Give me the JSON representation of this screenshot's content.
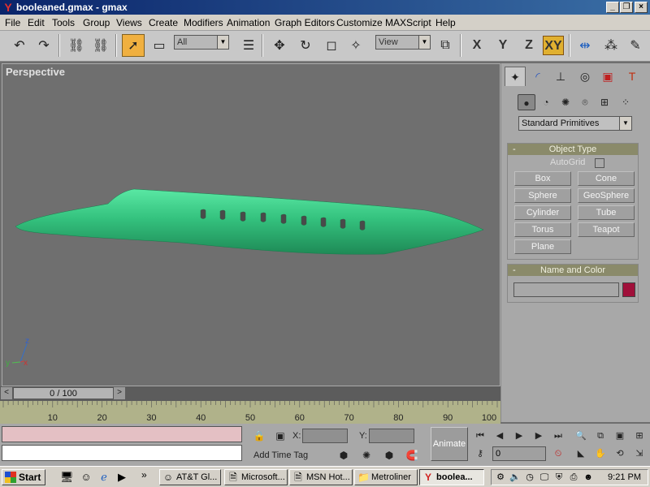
{
  "window": {
    "title": "booleaned.gmax - gmax",
    "minimize_label": "_",
    "restore_label": "❐",
    "close_label": "×"
  },
  "menu": [
    "File",
    "Edit",
    "Tools",
    "Group",
    "Views",
    "Create",
    "Modifiers",
    "Animation",
    "Graph Editors",
    "Customize",
    "MAXScript",
    "Help"
  ],
  "toolbar": {
    "selection_filter": "All",
    "ref_coord": "View",
    "axis_x": "X",
    "axis_y": "Y",
    "axis_z": "Z",
    "axis_xy": "XY"
  },
  "viewport": {
    "label": "Perspective",
    "axis_x": "x",
    "axis_y": "y",
    "axis_z": "z",
    "object_color": "#3ac880"
  },
  "command_panel": {
    "category": "Standard Primitives",
    "object_type": {
      "title": "Object Type",
      "autogrid": "AutoGrid",
      "buttons": [
        "Box",
        "Cone",
        "Sphere",
        "GeoSphere",
        "Cylinder",
        "Tube",
        "Torus",
        "Teapot",
        "Plane"
      ]
    },
    "name_color": {
      "title": "Name and Color",
      "swatch_color": "#a0103a"
    },
    "rollout_minus": "-"
  },
  "time_slider": {
    "position": "0 / 100",
    "prev": "<",
    "next": ">"
  },
  "track_bar": {
    "labels": [
      "10",
      "20",
      "30",
      "40",
      "50",
      "60",
      "70",
      "80",
      "90",
      "100"
    ]
  },
  "status": {
    "x_label": "X:",
    "y_label": "Y:",
    "add_time_tag": "Add Time Tag",
    "animate": "Animate",
    "frame_value": "0"
  },
  "taskbar": {
    "start": "Start",
    "chevron": "»",
    "tasks": [
      "AT&T Gl...",
      "Microsoft...",
      "MSN Hot...",
      "Metroliner",
      "boolea..."
    ],
    "clock": "9:21 PM"
  }
}
